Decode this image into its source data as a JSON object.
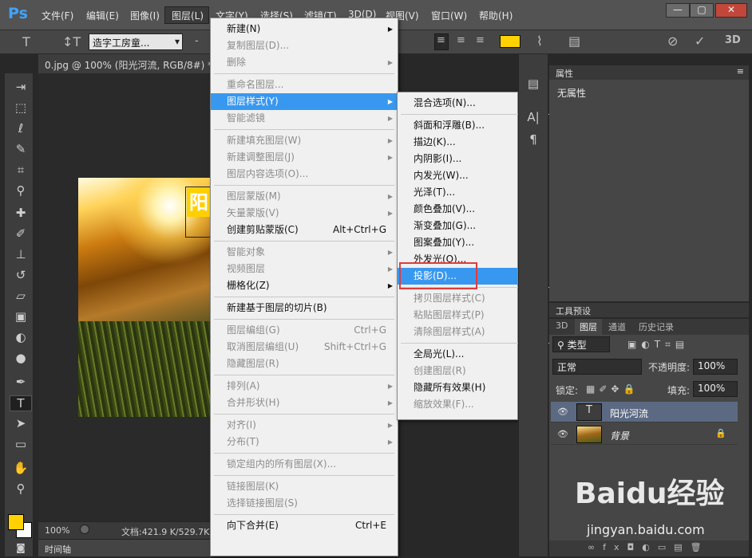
{
  "app": {
    "logo": "Ps"
  },
  "menubar": {
    "items": [
      "文件(F)",
      "编辑(E)",
      "图像(I)",
      "图层(L)",
      "文字(Y)",
      "选择(S)",
      "滤镜(T)",
      "3D(D)",
      "视图(V)",
      "窗口(W)",
      "帮助(H)"
    ]
  },
  "window_buttons": {
    "minimize": "—",
    "maximize": "▢",
    "close": "✕"
  },
  "options": {
    "font_family": "造字工房童...",
    "dash": "-",
    "aa_value": "",
    "brand_color": "#ffd200"
  },
  "document": {
    "tab_title": "0.jpg @ 100% (阳光河流, RGB/8#) *",
    "close": "×",
    "text_layer_glyph": "阳"
  },
  "status": {
    "zoom": "100%",
    "doc_info": "文档:421.9 K/529.7K"
  },
  "timeline": {
    "label": "时间轴"
  },
  "layer_menu": [
    {
      "label": "新建(N)",
      "submenu": true,
      "disabled": false
    },
    {
      "label": "复制图层(D)...",
      "disabled": true
    },
    {
      "label": "删除",
      "submenu": true,
      "disabled": true
    },
    {
      "sep": true
    },
    {
      "label": "重命名图层...",
      "disabled": true
    },
    {
      "label": "图层样式(Y)",
      "submenu": true,
      "highlight": true
    },
    {
      "label": "智能滤镜",
      "submenu": true,
      "disabled": true
    },
    {
      "sep": true
    },
    {
      "label": "新建填充图层(W)",
      "submenu": true,
      "disabled": true
    },
    {
      "label": "新建调整图层(J)",
      "submenu": true,
      "disabled": true
    },
    {
      "label": "图层内容选项(O)...",
      "disabled": true
    },
    {
      "sep": true
    },
    {
      "label": "图层蒙版(M)",
      "submenu": true,
      "disabled": true
    },
    {
      "label": "矢量蒙版(V)",
      "submenu": true,
      "disabled": true
    },
    {
      "label": "创建剪贴蒙版(C)",
      "shortcut": "Alt+Ctrl+G",
      "disabled": false
    },
    {
      "sep": true
    },
    {
      "label": "智能对象",
      "submenu": true,
      "disabled": true
    },
    {
      "label": "视频图层",
      "submenu": true,
      "disabled": true
    },
    {
      "label": "栅格化(Z)",
      "submenu": true,
      "disabled": false
    },
    {
      "sep": true
    },
    {
      "label": "新建基于图层的切片(B)",
      "disabled": false
    },
    {
      "sep": true
    },
    {
      "label": "图层编组(G)",
      "shortcut": "Ctrl+G",
      "disabled": true
    },
    {
      "label": "取消图层编组(U)",
      "shortcut": "Shift+Ctrl+G",
      "disabled": true
    },
    {
      "label": "隐藏图层(R)",
      "disabled": true
    },
    {
      "sep": true
    },
    {
      "label": "排列(A)",
      "submenu": true,
      "disabled": true
    },
    {
      "label": "合并形状(H)",
      "submenu": true,
      "disabled": true
    },
    {
      "sep": true
    },
    {
      "label": "对齐(I)",
      "submenu": true,
      "disabled": true
    },
    {
      "label": "分布(T)",
      "submenu": true,
      "disabled": true
    },
    {
      "sep": true
    },
    {
      "label": "锁定组内的所有图层(X)...",
      "disabled": true
    },
    {
      "sep": true
    },
    {
      "label": "链接图层(K)",
      "disabled": true
    },
    {
      "label": "选择链接图层(S)",
      "disabled": true
    },
    {
      "sep": true
    },
    {
      "label": "向下合并(E)",
      "shortcut": "Ctrl+E",
      "disabled": false
    }
  ],
  "style_submenu": [
    {
      "label": "混合选项(N)...",
      "disabled": false
    },
    {
      "sep": true
    },
    {
      "label": "斜面和浮雕(B)...",
      "disabled": false
    },
    {
      "label": "描边(K)...",
      "disabled": false
    },
    {
      "label": "内阴影(I)...",
      "disabled": false
    },
    {
      "label": "内发光(W)...",
      "disabled": false
    },
    {
      "label": "光泽(T)...",
      "disabled": false
    },
    {
      "label": "颜色叠加(V)...",
      "disabled": false
    },
    {
      "label": "渐变叠加(G)...",
      "disabled": false
    },
    {
      "label": "图案叠加(Y)...",
      "disabled": false
    },
    {
      "label": "外发光(O)...",
      "disabled": false
    },
    {
      "label": "投影(D)...",
      "highlight": true
    },
    {
      "sep": true
    },
    {
      "label": "拷贝图层样式(C)",
      "disabled": true
    },
    {
      "label": "粘贴图层样式(P)",
      "disabled": true
    },
    {
      "label": "清除图层样式(A)",
      "disabled": true
    },
    {
      "sep": true
    },
    {
      "label": "全局光(L)...",
      "disabled": false
    },
    {
      "label": "创建图层(R)",
      "disabled": true
    },
    {
      "label": "隐藏所有效果(H)",
      "disabled": false
    },
    {
      "label": "缩放效果(F)...",
      "disabled": true
    }
  ],
  "properties": {
    "title": "属性",
    "body": "无属性"
  },
  "presets": {
    "title": "工具预设"
  },
  "layers_panel": {
    "tabs": [
      "3D",
      "图层",
      "通道",
      "历史记录"
    ],
    "filter_kind": "类型",
    "blend_mode": "正常",
    "opacity_label": "不透明度:",
    "opacity": "100%",
    "lock_label": "锁定:",
    "fill_label": "填充:",
    "fill": "100%",
    "layers": [
      {
        "name": "阳光河流",
        "type": "text",
        "selected": true
      },
      {
        "name": "背景",
        "type": "image",
        "selected": false
      }
    ]
  },
  "watermark": {
    "text": "Baidu经验",
    "url": "jingyan.baidu.com"
  }
}
